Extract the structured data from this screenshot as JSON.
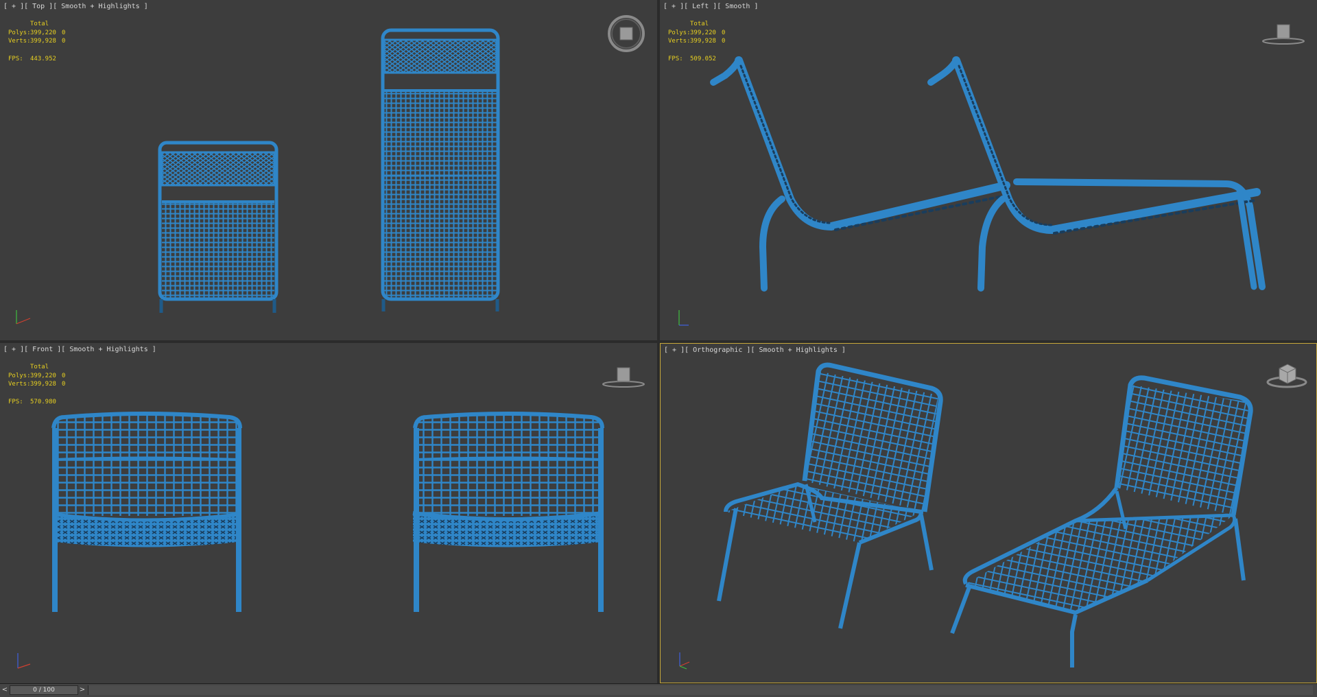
{
  "viewports": {
    "top": {
      "label": "[ + ][ Top ][ Smooth + Highlights ]",
      "stats": {
        "total": "Total",
        "polys_label": "Polys:",
        "polys_value": "399,220",
        "polys_sel": "0",
        "verts_label": "Verts:",
        "verts_value": "399,928",
        "verts_sel": "0",
        "fps_label": "FPS:",
        "fps_value": "443.952"
      }
    },
    "left": {
      "label": "[ + ][ Left ][ Smooth ]",
      "stats": {
        "total": "Total",
        "polys_label": "Polys:",
        "polys_value": "399,220",
        "polys_sel": "0",
        "verts_label": "Verts:",
        "verts_value": "399,928",
        "verts_sel": "0",
        "fps_label": "FPS:",
        "fps_value": "509.052"
      }
    },
    "front": {
      "label": "[ + ][ Front ][ Smooth + Highlights ]",
      "stats": {
        "total": "Total",
        "polys_label": "Polys:",
        "polys_value": "399,220",
        "polys_sel": "0",
        "verts_label": "Verts:",
        "verts_value": "399,928",
        "verts_sel": "0",
        "fps_label": "FPS:",
        "fps_value": "570.980"
      }
    },
    "ortho": {
      "label": "[ + ][ Orthographic ][ Smooth + Highlights ]"
    }
  },
  "timeline": {
    "prev": "<",
    "next": ">",
    "frame": "0 / 100"
  },
  "colors": {
    "model": "#2f86c8",
    "viewport_bg": "#3d3d3d",
    "active_border": "#c8a83a",
    "stats": "#e8d020"
  }
}
